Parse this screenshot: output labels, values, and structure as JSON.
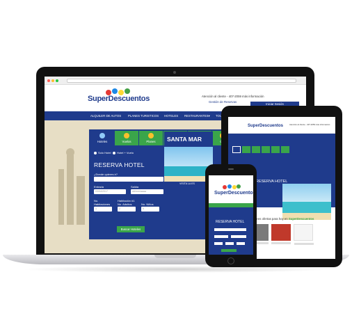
{
  "laptop": {
    "site": {
      "logo_text": "SuperDescuentos",
      "contact": "Atención al cliente - 407-2059 más información",
      "manage_link": "Gestión de Reservas",
      "login_button": "Iniciar Sesión",
      "nav": [
        "ALQUILER DE AUTOS",
        "PLANES TURISTICOS",
        "HOTELES",
        "RESTAURANTES▾",
        "TOURE"
      ],
      "tabs": [
        "Hoteles",
        "Vuelos",
        "Planes",
        "Tours",
        "Traslados",
        "Carr"
      ],
      "radio_options": [
        "Solo Hotel",
        "Hotel + Vuelo"
      ],
      "form_title": "RESERVA HOTEL",
      "fields": {
        "destination_label": "¿Donde quieres ir?",
        "checkin_label": "Entrada",
        "checkin_value": "03/04/2017",
        "checkout_label": "Salida",
        "checkout_placeholder": "dd/mm/aaaa",
        "rooms_label": "No. Habitaciones",
        "adults_label": "Habitación #1\nNo. Adultos",
        "children_label": "No. Niños",
        "rooms_value": "1",
        "adults_value": "2",
        "children_value": "0"
      },
      "search_button": "Buscar Hoteles",
      "promo_title": "SANTA MAR",
      "promo_footer": "VISITA LA ES"
    }
  },
  "tablet": {
    "form_title": "RESERVA HOTEL",
    "offers_text": "Las mejores ofertas para hoy en",
    "offers_brand": "SuperDescuentos"
  },
  "phone": {
    "logo_text": "SuperDescuentos",
    "form_title": "RESERVA HOTEL"
  },
  "colors": {
    "brand_blue": "#1f3b8c",
    "brand_green": "#3aa54a",
    "accent_yellow": "#fbc02d",
    "accent_red": "#e53935"
  }
}
